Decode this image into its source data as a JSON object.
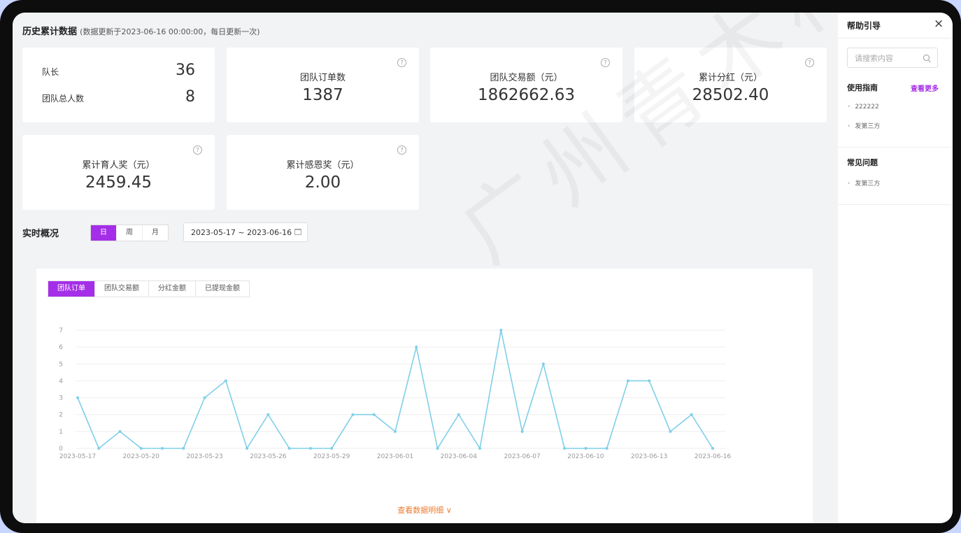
{
  "header": {
    "title": "历史累计数据",
    "subtitle": "(数据更新于2023-06-16 00:00:00，每日更新一次)"
  },
  "stats": {
    "captain_label": "队长",
    "captain_value": "36",
    "team_total_label": "团队总人数",
    "team_total_value": "8",
    "orders_label": "团队订单数",
    "orders_value": "1387",
    "trade_label": "团队交易额（元）",
    "trade_value": "1862662.63",
    "dividend_label": "累计分红（元）",
    "dividend_value": "28502.40",
    "nurture_label": "累计育人奖（元）",
    "nurture_value": "2459.45",
    "gratitude_label": "累计感恩奖（元）",
    "gratitude_value": "2.00"
  },
  "realtime": {
    "title": "实时概况",
    "periods": [
      "日",
      "周",
      "月"
    ],
    "active_period": "日",
    "date_range": "2023-05-17 ~ 2023-06-16"
  },
  "chart_tabs": [
    "团队订单",
    "团队交易额",
    "分红金额",
    "已提现金额"
  ],
  "active_chart_tab": "团队订单",
  "detail_link": "查看数据明细 ∨",
  "help": {
    "title": "帮助引导",
    "close": "×",
    "search_placeholder": "请搜索内容",
    "guide_title": "使用指南",
    "see_more": "查看更多",
    "guide_items": [
      "222222",
      "发第三方"
    ],
    "faq_title": "常见问题",
    "faq_items": [
      "发第三方"
    ]
  },
  "watermark": "广州青木科技有限公",
  "colors": {
    "accent": "#a52fe8",
    "line": "#7fcfe9",
    "link": "#ee7a2e"
  },
  "chart_data": {
    "type": "line",
    "x": [
      "2023-05-17",
      "2023-05-18",
      "2023-05-19",
      "2023-05-20",
      "2023-05-21",
      "2023-05-22",
      "2023-05-23",
      "2023-05-24",
      "2023-05-25",
      "2023-05-26",
      "2023-05-27",
      "2023-05-28",
      "2023-05-29",
      "2023-05-30",
      "2023-05-31",
      "2023-06-01",
      "2023-06-02",
      "2023-06-03",
      "2023-06-04",
      "2023-06-05",
      "2023-06-06",
      "2023-06-07",
      "2023-06-08",
      "2023-06-09",
      "2023-06-10",
      "2023-06-11",
      "2023-06-12",
      "2023-06-13",
      "2023-06-14",
      "2023-06-15",
      "2023-06-16"
    ],
    "x_tick_labels": [
      "2023-05-17",
      "2023-05-20",
      "2023-05-23",
      "2023-05-26",
      "2023-05-29",
      "2023-06-01",
      "2023-06-04",
      "2023-06-07",
      "2023-06-10",
      "2023-06-13",
      "2023-06-16"
    ],
    "series": [
      {
        "values": [
          3,
          0,
          1,
          0,
          0,
          0,
          3,
          4,
          0,
          2,
          0,
          0,
          0,
          2,
          2,
          1,
          6,
          0,
          2,
          0,
          7,
          1,
          5,
          0,
          0,
          0,
          4,
          4,
          1,
          2,
          0
        ]
      }
    ],
    "ylim": [
      0,
      7
    ],
    "y_ticks": [
      0,
      1,
      2,
      3,
      4,
      5,
      6,
      7
    ],
    "grid": true
  }
}
